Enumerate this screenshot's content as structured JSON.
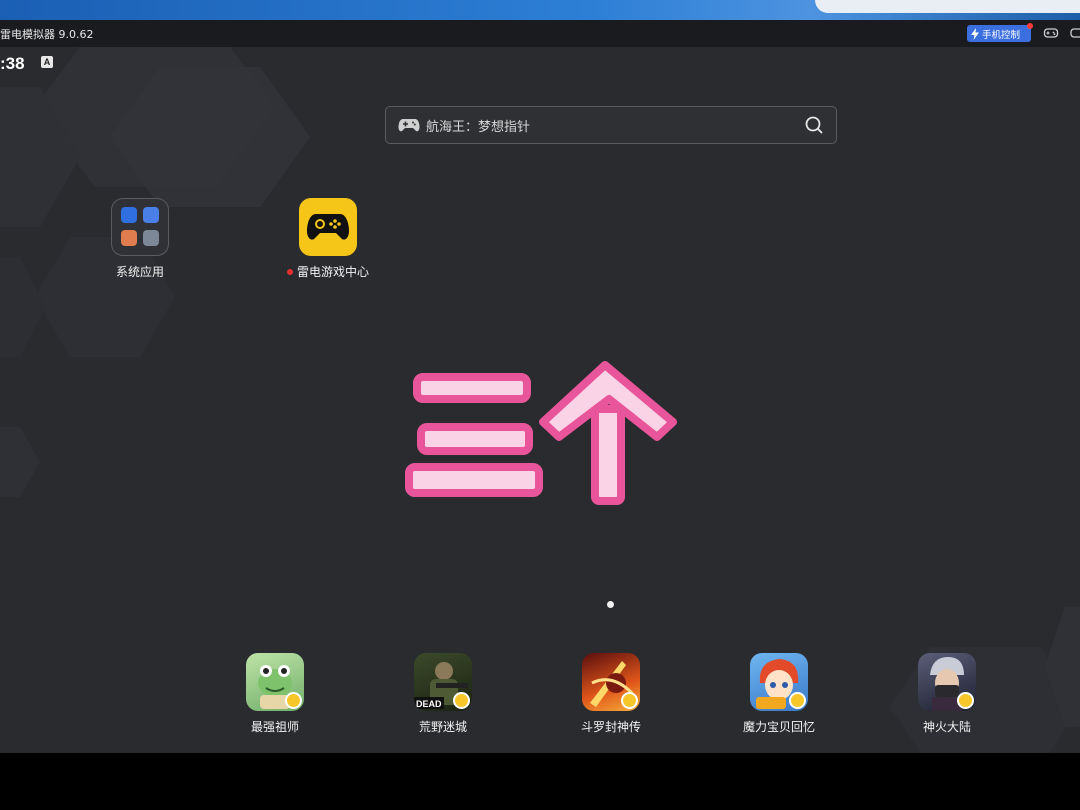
{
  "window": {
    "title": "雷电模拟器 9.0.62",
    "phone_control_label": "手机控制"
  },
  "status_bar": {
    "time": ":38",
    "keyboard_indicator": "A"
  },
  "search": {
    "placeholder": "航海王：梦想指针"
  },
  "desktop_apps": [
    {
      "label": "系统应用",
      "icon": "folder-icon"
    },
    {
      "label": "雷电游戏中心",
      "icon": "gamepad-icon",
      "has_notification_dot": true
    }
  ],
  "overlay_text": "三个",
  "pager": {
    "pages": 1,
    "current": 1
  },
  "dock_apps": [
    {
      "label": "最强祖师",
      "icon": "frog-game-icon"
    },
    {
      "label": "荒野迷城",
      "icon": "soldier-game-icon"
    },
    {
      "label": "斗罗封神传",
      "icon": "fire-warrior-game-icon"
    },
    {
      "label": "魔力宝贝回忆",
      "icon": "anime-girl-game-icon"
    },
    {
      "label": "神火大陆",
      "icon": "masked-hero-game-icon"
    }
  ],
  "colors": {
    "desktop_bg": "#2a2b2f",
    "accent_blue": "#3b6fe0",
    "game_center_yellow": "#f5c518",
    "overlay_pink": "#e9559b",
    "overlay_fill": "#fbd3e6"
  }
}
